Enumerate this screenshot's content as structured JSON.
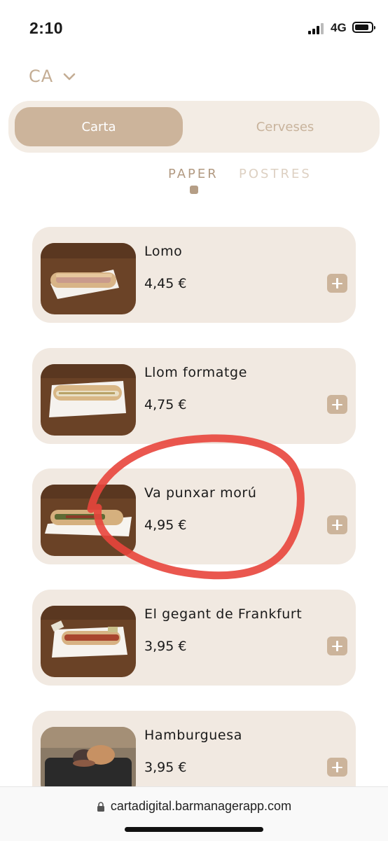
{
  "status_bar": {
    "time": "2:10",
    "network": "4G"
  },
  "language": {
    "code": "CA",
    "icon": "chevron-down-icon"
  },
  "tabs": [
    {
      "label": "Carta",
      "active": true
    },
    {
      "label": "Cerveses",
      "active": false
    }
  ],
  "categories": [
    {
      "label": "PAPER",
      "active": true
    },
    {
      "label": "POSTRES",
      "active": false
    }
  ],
  "products": [
    {
      "name": "Lomo",
      "price": "4,45 €"
    },
    {
      "name": "Llom formatge",
      "price": "4,75 €"
    },
    {
      "name": "Va punxar morú",
      "price": "4,95 €"
    },
    {
      "name": "El gegant de Frankfurt",
      "price": "3,95 €"
    },
    {
      "name": "Hamburguesa",
      "price": "3,95 €"
    }
  ],
  "url_bar": {
    "url": "cartadigital.barmanagerapp.com",
    "icon": "lock-icon"
  },
  "colors": {
    "accent": "#ccb49b",
    "card_background": "#f1e9e1",
    "annotation": "#e8453c"
  }
}
